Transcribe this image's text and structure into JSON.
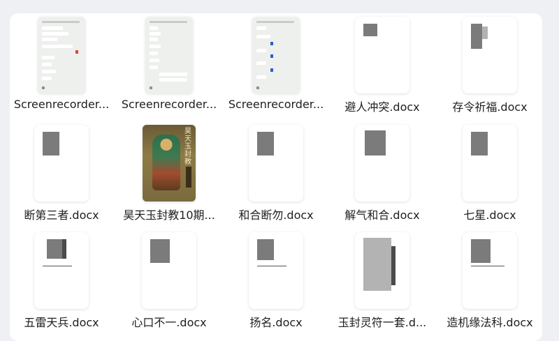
{
  "files": [
    {
      "name": "Screenrecorder...",
      "kind": "chat"
    },
    {
      "name": "Screenrecorder...",
      "kind": "chat"
    },
    {
      "name": "Screenrecorder...",
      "kind": "chat"
    },
    {
      "name": "避人冲突.docx",
      "kind": "docx"
    },
    {
      "name": "存令祈福.docx",
      "kind": "docx"
    },
    {
      "name": "断第三者.docx",
      "kind": "docx"
    },
    {
      "name": "昊天玉封教10期...",
      "kind": "book"
    },
    {
      "name": "和合断勿.docx",
      "kind": "docx"
    },
    {
      "name": "解气和合.docx",
      "kind": "docx"
    },
    {
      "name": "七星.docx",
      "kind": "docx"
    },
    {
      "name": "五雷天兵.docx",
      "kind": "docx"
    },
    {
      "name": "心口不一.docx",
      "kind": "docx"
    },
    {
      "name": "扬名.docx",
      "kind": "docx"
    },
    {
      "name": "玉封灵符一套.d...",
      "kind": "docx"
    },
    {
      "name": "造机缘法科.docx",
      "kind": "docx"
    }
  ],
  "book_cover_title": "昊天玉封教"
}
